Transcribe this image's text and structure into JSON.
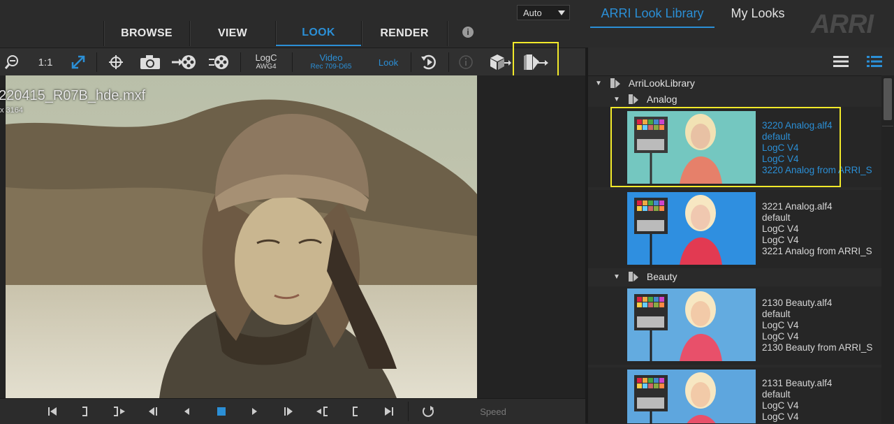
{
  "nav": {
    "tabs": [
      "BROWSE",
      "VIEW",
      "LOOK",
      "RENDER"
    ],
    "active": "LOOK",
    "info_glyph": "i",
    "logo": "ARRI"
  },
  "toolbar": {
    "zoom_ratio": "1:1",
    "logc_label": "LogC",
    "logc_sub": "AWG4",
    "video_label": "Video",
    "video_sub": "Rec 709-D65",
    "look_label": "Look",
    "icons": [
      "zoom-out-icon",
      "fit-screen-icon",
      "crosshair-icon",
      "camera-icon",
      "film-export-icon",
      "film-settings-icon",
      "reset-look-icon",
      "info-icon",
      "cube-export-icon",
      "look-export-icon"
    ]
  },
  "viewer": {
    "clip_name": "220415_R07B_hde.mxf",
    "resolution": "x 3164"
  },
  "transport": {
    "speed_label": "Speed",
    "speed_value": "Auto"
  },
  "panel": {
    "tabs": [
      "ARRI Look Library",
      "My Looks"
    ],
    "active_tab": "ARRI Look Library",
    "root": "ArriLookLibrary",
    "groups": [
      {
        "name": "Analog",
        "entries": [
          {
            "file": "3220 Analog.alf4",
            "variant": "default",
            "input": "LogC V4",
            "output": "LogC V4",
            "desc": "3220 Analog from ARRI_S",
            "selected": true,
            "bg": "#74c7c0"
          },
          {
            "file": "3221 Analog.alf4",
            "variant": "default",
            "input": "LogC V4",
            "output": "LogC V4",
            "desc": "3221 Analog from ARRI_S",
            "selected": false,
            "bg": "#2f8fe0"
          }
        ]
      },
      {
        "name": "Beauty",
        "entries": [
          {
            "file": "2130 Beauty.alf4",
            "variant": "default",
            "input": "LogC V4",
            "output": "LogC V4",
            "desc": "2130 Beauty from ARRI_S",
            "selected": false,
            "bg": "#63abe0"
          },
          {
            "file": "2131 Beauty.alf4",
            "variant": "default",
            "input": "LogC V4",
            "output": "LogC V4",
            "desc": "",
            "selected": false,
            "bg": "#5ea6de"
          }
        ]
      }
    ]
  },
  "colors": {
    "accent": "#2b8fd6",
    "highlight": "#f2ea2a"
  }
}
